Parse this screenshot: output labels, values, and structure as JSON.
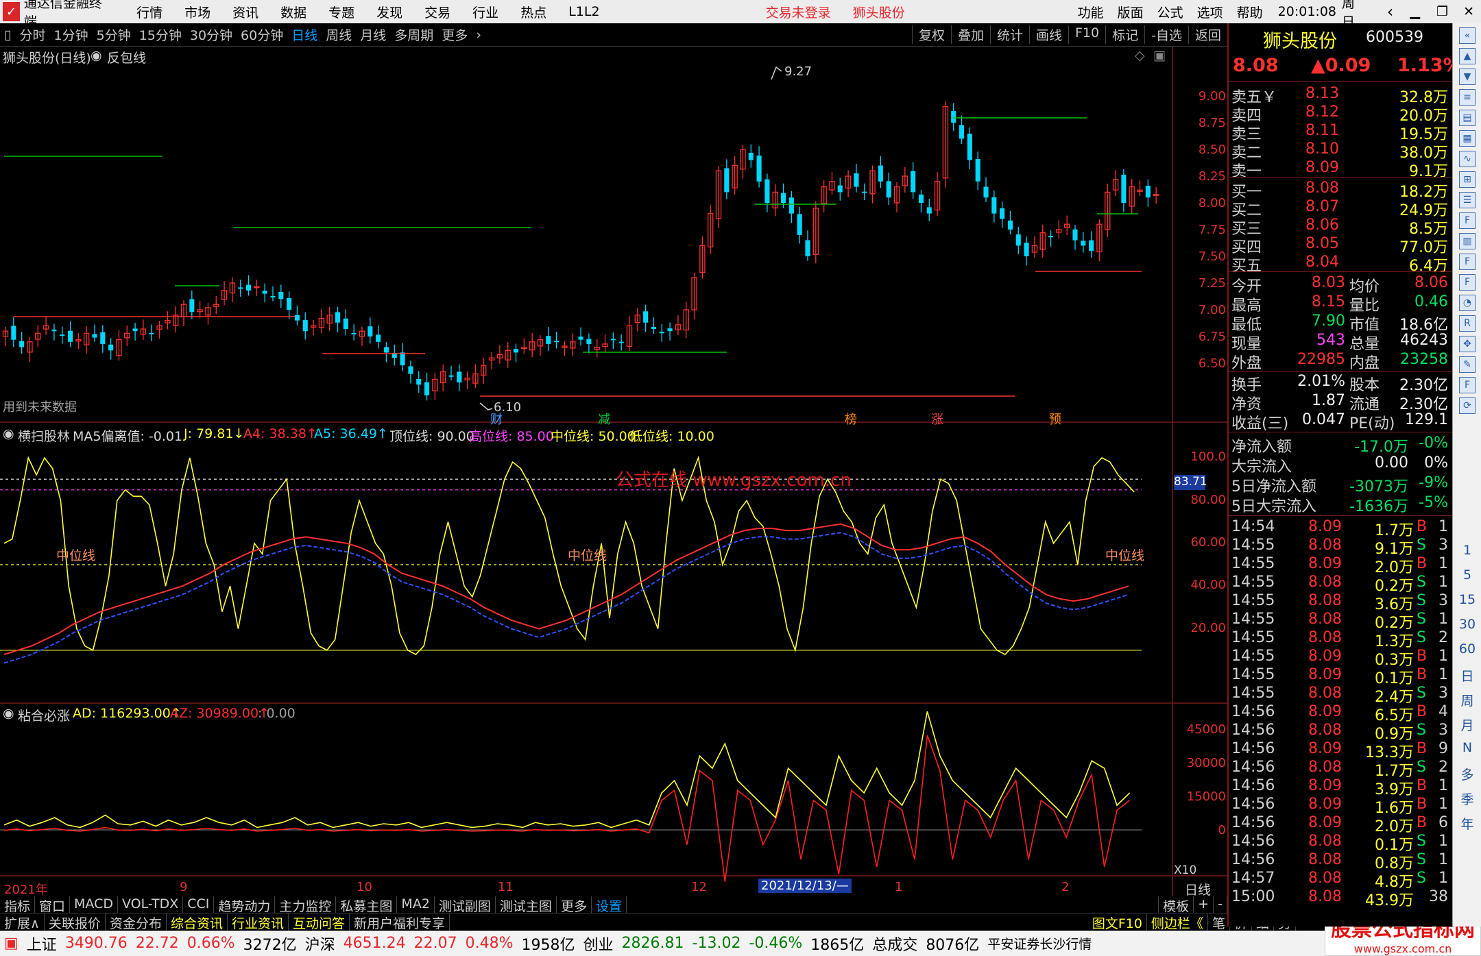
{
  "titlebar": {
    "app_name": "通达信金融终端",
    "menus": [
      "行情",
      "市场",
      "资讯",
      "数据",
      "专题",
      "发现",
      "交易",
      "行业",
      "热点",
      "L1L2"
    ],
    "trade_status": "交易未登录",
    "stock_name": "狮头股份",
    "right_menus": [
      "功能",
      "版面",
      "公式",
      "选项",
      "帮助"
    ],
    "time": "20:01:08",
    "weekday": "周日"
  },
  "periodbar": {
    "periods": [
      "分时",
      "1分钟",
      "5分钟",
      "15分钟",
      "30分钟",
      "60分钟",
      "日线",
      "周线",
      "月线",
      "多周期",
      "更多"
    ],
    "active": "日线",
    "actions": [
      "复权",
      "叠加",
      "统计",
      "画线",
      "F10",
      "标记",
      "-自选",
      "返回"
    ]
  },
  "main_chart": {
    "header_name": "狮头股份(日线)",
    "header_indicator": "反包线",
    "footnote": "用到未来数据",
    "price_ticks": [
      "9.00",
      "8.75",
      "8.50",
      "8.25",
      "8.00",
      "7.75",
      "7.50",
      "7.25",
      "7.00",
      "6.75",
      "6.50"
    ],
    "high_label": "9.27",
    "low_label": "6.10",
    "markers": [
      {
        "text": "财",
        "color": "#4aa0ff"
      },
      {
        "text": "减",
        "color": "#00cc44"
      },
      {
        "text": "榜",
        "color": "#ff8c00"
      },
      {
        "text": "涨",
        "color": "#ff4040"
      },
      {
        "text": "预",
        "color": "#ff8c00"
      }
    ]
  },
  "sub_chart1": {
    "name": "横扫股林",
    "params": [
      {
        "text": "MA5偏离值: -0.01",
        "color": "#d8d8d8"
      },
      {
        "text": "J: 79.81↓",
        "color": "#ffff33"
      },
      {
        "text": "A4: 38.38↑",
        "color": "#ff3030"
      },
      {
        "text": "A5: 36.49↑",
        "color": "#00d7ff"
      },
      {
        "text": "顶位线: 90.00",
        "color": "#d8d8d8"
      },
      {
        "text": "高位线: 85.00",
        "color": "#ff44ff"
      },
      {
        "text": "中位线: 50.00",
        "color": "#ffff33"
      },
      {
        "text": "低位线: 10.00",
        "color": "#ffff33"
      }
    ],
    "ticks": [
      "100.0",
      "80.00",
      "60.00",
      "40.00",
      "20.00"
    ],
    "current_value": "83.71",
    "mid_labels": [
      "中位线",
      "中位线",
      "中位线"
    ],
    "watermark": "公式在线 www.gszx.com.cn"
  },
  "sub_chart2": {
    "name": "粘合必涨",
    "params": [
      {
        "text": "AD: 116293.00↑",
        "color": "#ffff33"
      },
      {
        "text": "AZ: 30989.00↑",
        "color": "#ff3030"
      },
      {
        "text": ": 0.00",
        "color": "#a0a0a0"
      }
    ],
    "ticks": [
      "45000",
      "30000",
      "15000",
      "0"
    ],
    "scale": "X10"
  },
  "date_axis": {
    "labels": [
      "2021年",
      "9",
      "10",
      "11",
      "12",
      "2021/12/13/—",
      "1",
      "2"
    ],
    "period": "日线"
  },
  "tabs1": {
    "items": [
      "指标",
      "窗口",
      "MACD",
      "VOL-TDX",
      "CCI",
      "趋势动力",
      "主力监控",
      "私募主图",
      "MA2",
      "测试副图",
      "测试主图",
      "更多",
      "设置"
    ],
    "active": "设置",
    "right": [
      "模板",
      "+",
      "-"
    ]
  },
  "tabs2": {
    "items": [
      "扩展∧",
      "关联报价",
      "资金分布",
      "综合资讯",
      "行业资讯",
      "互动问答",
      "新用户福利专享"
    ],
    "highlight": [
      "综合资讯",
      "行业资讯",
      "互动问答"
    ],
    "right": [
      "图文F10",
      "侧边栏《",
      "笔",
      "价",
      "细",
      "势"
    ]
  },
  "statusbar": {
    "items": [
      {
        "name": "上证",
        "value": "3490.76",
        "chg": "22.72",
        "pct": "0.66%",
        "vol": "3272亿"
      },
      {
        "name": "沪深",
        "value": "4651.24",
        "chg": "22.07",
        "pct": "0.48%",
        "vol": "1958亿"
      },
      {
        "name": "创业",
        "value": "2826.81",
        "chg": "-13.02",
        "pct": "-0.46%",
        "vol": "1865亿"
      }
    ],
    "total_label": "总成交",
    "total_value": "8076亿",
    "broker": "平安证券长沙行情",
    "logo_text": "股票公式指标网",
    "logo_url": "www.gszx.com.cn"
  },
  "quote_panel": {
    "name": "狮头股份",
    "code": "600539",
    "price": "8.08",
    "change": "▲0.09",
    "pct": "1.13%",
    "asks": [
      {
        "label": "卖五￥",
        "price": "8.13",
        "vol": "32.8万"
      },
      {
        "label": "卖四",
        "price": "8.12",
        "vol": "20.0万"
      },
      {
        "label": "卖三",
        "price": "8.11",
        "vol": "19.5万"
      },
      {
        "label": "卖二",
        "price": "8.10",
        "vol": "38.0万"
      },
      {
        "label": "卖一",
        "price": "8.09",
        "vol": "9.1万"
      }
    ],
    "bids": [
      {
        "label": "买一",
        "price": "8.08",
        "vol": "18.2万"
      },
      {
        "label": "买二",
        "price": "8.07",
        "vol": "24.9万"
      },
      {
        "label": "买三",
        "price": "8.06",
        "vol": "8.5万"
      },
      {
        "label": "买四",
        "price": "8.05",
        "vol": "77.0万"
      },
      {
        "label": "买五",
        "price": "8.04",
        "vol": "6.4万"
      }
    ],
    "stats": [
      {
        "l1": "今开",
        "v1": "8.03",
        "c1": "#ff3030",
        "l2": "均价",
        "v2": "8.06",
        "c2": "#ff3030"
      },
      {
        "l1": "最高",
        "v1": "8.15",
        "c1": "#ff3030",
        "l2": "量比",
        "v2": "0.46",
        "c2": "#00e060"
      },
      {
        "l1": "最低",
        "v1": "7.90",
        "c1": "#00e060",
        "l2": "市值",
        "v2": "18.6亿",
        "c2": "#f0f0f0"
      },
      {
        "l1": "现量",
        "v1": "543",
        "c1": "#ff44ff",
        "l2": "总量",
        "v2": "46243",
        "c2": "#f0f0f0"
      },
      {
        "l1": "外盘",
        "v1": "22985",
        "c1": "#ff3030",
        "l2": "内盘",
        "v2": "23258",
        "c2": "#00e060"
      }
    ],
    "fund": [
      {
        "l1": "换手",
        "v1": "2.01%",
        "l2": "股本",
        "v2": "2.30亿"
      },
      {
        "l1": "净资",
        "v1": "1.87",
        "l2": "流通",
        "v2": "2.30亿"
      },
      {
        "l1": "收益(三)",
        "v1": "0.047",
        "l2": "PE(动)",
        "v2": "129.1"
      }
    ],
    "flows": [
      {
        "label": "净流入额",
        "value": "-17.0万",
        "pct": "-0%",
        "color": "#00e060"
      },
      {
        "label": "大宗流入",
        "value": "0.00",
        "pct": "0%",
        "color": "#f0f0f0"
      },
      {
        "label": "5日净流入额",
        "value": "-3073万",
        "pct": "-9%",
        "color": "#00e060"
      },
      {
        "label": "5日大宗流入",
        "value": "-1636万",
        "pct": "-5%",
        "color": "#00e060"
      }
    ],
    "ticks": [
      {
        "t": "14:54",
        "p": "8.09",
        "v": "1.7万",
        "d": "B",
        "n": "1"
      },
      {
        "t": "14:55",
        "p": "8.08",
        "v": "9.1万",
        "d": "S",
        "n": "3"
      },
      {
        "t": "14:55",
        "p": "8.09",
        "v": "2.0万",
        "d": "B",
        "n": "1"
      },
      {
        "t": "14:55",
        "p": "8.08",
        "v": "0.2万",
        "d": "S",
        "n": "1"
      },
      {
        "t": "14:55",
        "p": "8.08",
        "v": "3.6万",
        "d": "S",
        "n": "3"
      },
      {
        "t": "14:55",
        "p": "8.08",
        "v": "0.2万",
        "d": "S",
        "n": "1"
      },
      {
        "t": "14:55",
        "p": "8.08",
        "v": "1.3万",
        "d": "S",
        "n": "2"
      },
      {
        "t": "14:55",
        "p": "8.09",
        "v": "0.3万",
        "d": "B",
        "n": "1"
      },
      {
        "t": "14:55",
        "p": "8.09",
        "v": "0.1万",
        "d": "B",
        "n": "1"
      },
      {
        "t": "14:55",
        "p": "8.08",
        "v": "2.4万",
        "d": "S",
        "n": "3"
      },
      {
        "t": "14:56",
        "p": "8.09",
        "v": "6.5万",
        "d": "B",
        "n": "4"
      },
      {
        "t": "14:56",
        "p": "8.08",
        "v": "0.9万",
        "d": "S",
        "n": "3"
      },
      {
        "t": "14:56",
        "p": "8.09",
        "v": "13.3万",
        "d": "B",
        "n": "9"
      },
      {
        "t": "14:56",
        "p": "8.08",
        "v": "1.7万",
        "d": "S",
        "n": "2"
      },
      {
        "t": "14:56",
        "p": "8.09",
        "v": "3.9万",
        "d": "B",
        "n": "1"
      },
      {
        "t": "14:56",
        "p": "8.09",
        "v": "1.6万",
        "d": "B",
        "n": "1"
      },
      {
        "t": "14:56",
        "p": "8.09",
        "v": "2.0万",
        "d": "B",
        "n": "6"
      },
      {
        "t": "14:56",
        "p": "8.08",
        "v": "0.1万",
        "d": "S",
        "n": "1"
      },
      {
        "t": "14:56",
        "p": "8.08",
        "v": "0.8万",
        "d": "S",
        "n": "1"
      },
      {
        "t": "14:57",
        "p": "8.08",
        "v": "4.8万",
        "d": "S",
        "n": "1"
      },
      {
        "t": "15:00",
        "p": "8.08",
        "v": "43.9万",
        "d": "",
        "n": "38"
      }
    ]
  },
  "side_strip": {
    "icons": [
      "collapse-icon",
      "up-icon",
      "down-icon",
      "list-icon",
      "chart-icon",
      "grid-icon",
      "line-chart-icon",
      "kline-icon",
      "table-icon",
      "fin-icon",
      "bar-icon",
      "f10-icon",
      "f2-icon",
      "clock-icon",
      "rsi-icon",
      "move-icon",
      "pen-icon",
      "fs-icon",
      "sync-icon"
    ],
    "labels": [
      "1",
      "5",
      "15",
      "30",
      "60",
      "日",
      "周",
      "月",
      "N",
      "多",
      "季",
      "年"
    ]
  }
}
